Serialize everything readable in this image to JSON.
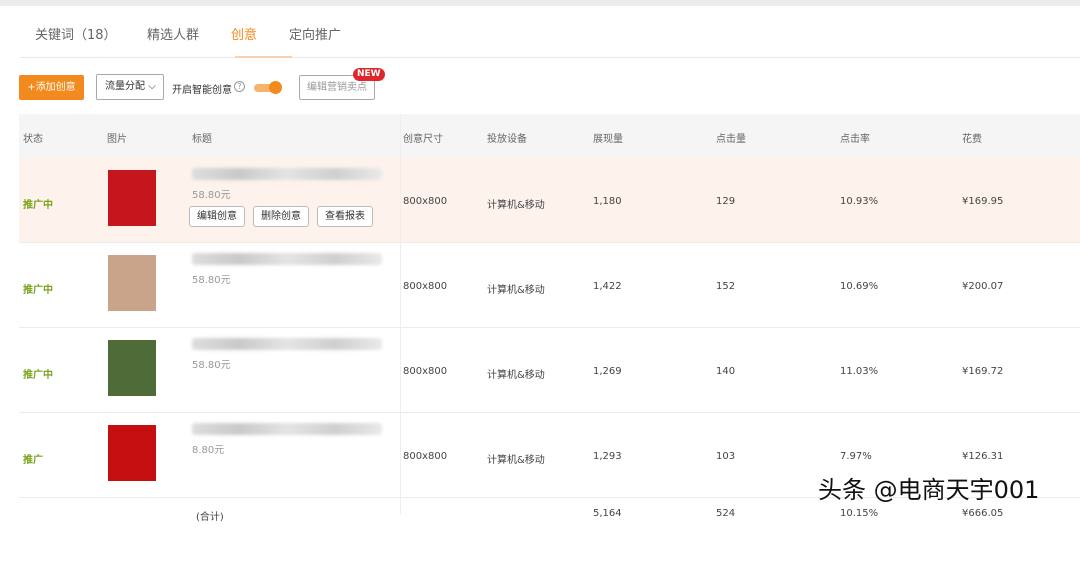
{
  "tabs": [
    {
      "label": "关键词（18）"
    },
    {
      "label": "精选人群"
    },
    {
      "label": "创意"
    },
    {
      "label": "定向推广"
    }
  ],
  "toolbar": {
    "add_label": "+添加创意",
    "traffic_select": "流量分配",
    "smart_label": "开启智能创意",
    "help": "?",
    "smart_enabled": true,
    "edit_selling_points": "编辑营销卖点",
    "new_badge": "NEW"
  },
  "table": {
    "headers": [
      "状态",
      "图片",
      "标题",
      "创意尺寸",
      "投放设备",
      "展现量",
      "点击量",
      "点击率",
      "花费"
    ],
    "rows": [
      {
        "status": "推广中",
        "price": "58.80元",
        "size": "800x800",
        "device": "计算机&移动",
        "impressions": "1,180",
        "clicks": "129",
        "ctr": "10.93%",
        "cost": "¥169.95",
        "image_color": "#c4161c"
      },
      {
        "status": "推广中",
        "price": "58.80元",
        "size": "800x800",
        "device": "计算机&移动",
        "impressions": "1,422",
        "clicks": "152",
        "ctr": "10.69%",
        "cost": "¥200.07",
        "image_color": "#c9a38a"
      },
      {
        "status": "推广中",
        "price": "58.80元",
        "size": "800x800",
        "device": "计算机&移动",
        "impressions": "1,269",
        "clicks": "140",
        "ctr": "11.03%",
        "cost": "¥169.72",
        "image_color": "#4f6b38"
      },
      {
        "status": "推广",
        "price": "8.80元",
        "size": "800x800",
        "device": "计算机&移动",
        "impressions": "1,293",
        "clicks": "103",
        "ctr": "7.97%",
        "cost": "¥126.31",
        "image_color": "#c40e10"
      }
    ],
    "row_actions": [
      "编辑创意",
      "删除创意",
      "查看报表"
    ],
    "total": {
      "label": "(合计)",
      "impressions": "5,164",
      "clicks": "524",
      "ctr": "10.15%",
      "cost": "¥666.05"
    }
  },
  "watermark": "头条 @电商天宇001"
}
